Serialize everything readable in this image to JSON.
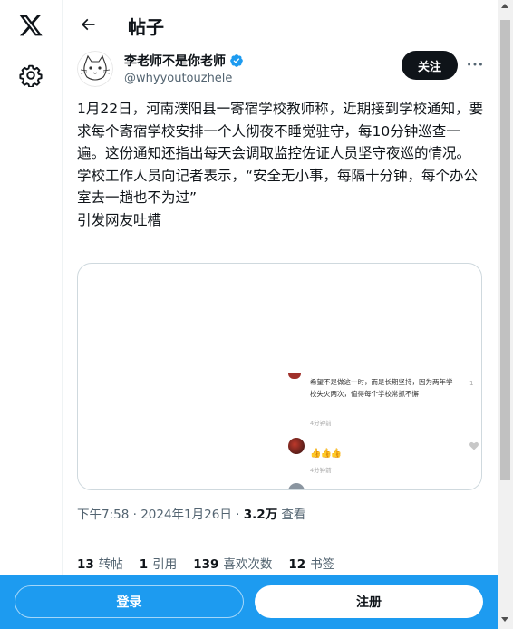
{
  "header": {
    "title": "帖子"
  },
  "author": {
    "display_name": "李老师不是你老师",
    "handle": "@whyyoutouzhele",
    "follow_label": "关注"
  },
  "tweet": {
    "paragraphs": [
      "1月22日，河南濮阳县一寄宿学校教师称，近期接到学校通知，要求每个寄宿学校安排一个人彻夜不睡觉驻守，每10分钟巡查一遍。这份通知还指出每天会调取监控佐证人员坚守夜巡的情况。",
      "学校工作人员向记者表示，“安全无小事，每隔十分钟，每个办公室去一趟也不为过”",
      "引发网友吐槽"
    ]
  },
  "media": {
    "comment1_text": "希望不是做这一时，而是长期坚持，因为两年学校失火两次，值得每个学校常抓不懈",
    "comment1_time": "4分钟前",
    "comment1_like_count": "1",
    "comment2_text": "👍👍👍",
    "comment2_time": "4分钟前"
  },
  "meta": {
    "time": "下午7:58",
    "sep1": " · ",
    "date": "2024年1月26日",
    "sep2": " · ",
    "views_count": "3.2万",
    "views_label": " 查看"
  },
  "stats": {
    "retweets_count": "13",
    "retweets_label": "转帖",
    "quotes_count": "1",
    "quotes_label": "引用",
    "likes_count": "139",
    "likes_label": "喜欢次数",
    "bookmarks_count": "12",
    "bookmarks_label": "书签"
  },
  "bottom": {
    "login_label": "登录",
    "signup_label": "注册"
  },
  "colors": {
    "accent": "#1d9bf0",
    "text": "#0f1419",
    "muted": "#536471"
  },
  "icons": [
    "x-logo-icon",
    "settings-icon",
    "back-arrow-icon",
    "verified-icon",
    "more-icon",
    "heart-icon"
  ]
}
